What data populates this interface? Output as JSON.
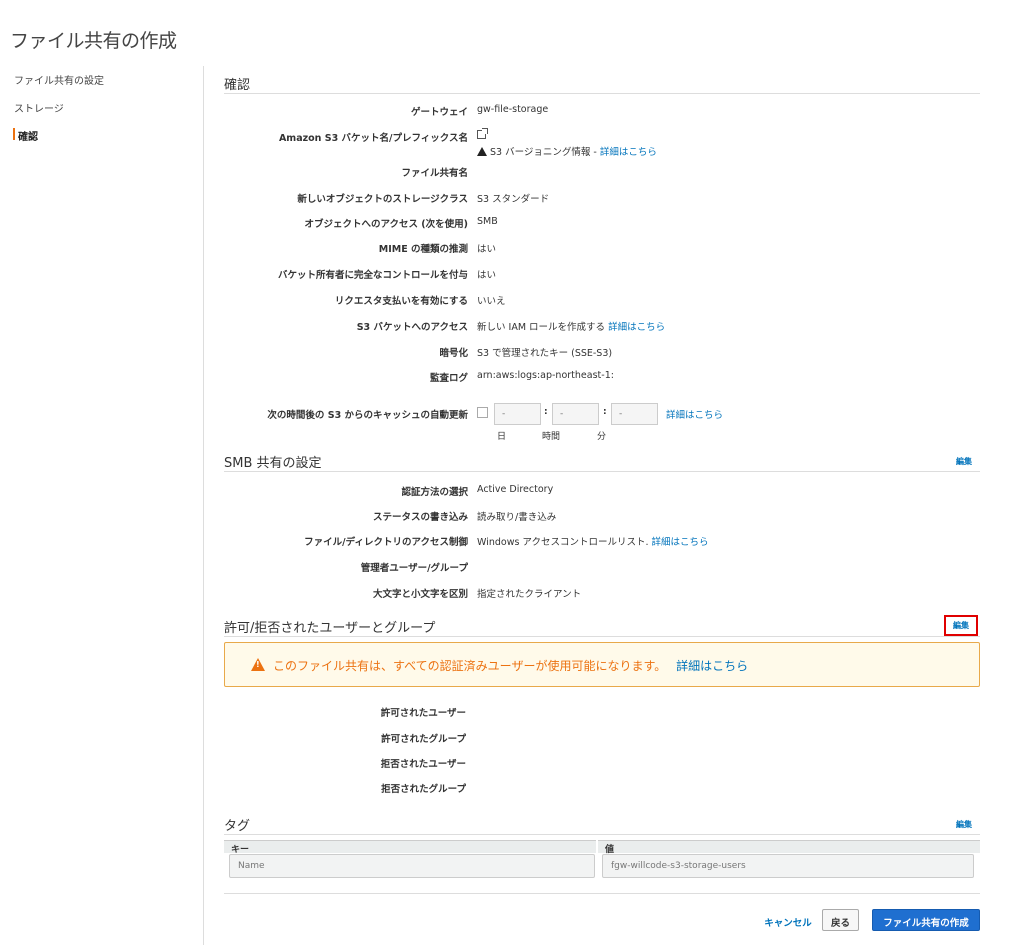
{
  "page_title": "ファイル共有の作成",
  "sidebar": {
    "items": [
      {
        "label": "ファイル共有の設定",
        "active": false
      },
      {
        "label": "ストレージ",
        "active": false
      },
      {
        "label": "確認",
        "active": true
      }
    ]
  },
  "confirm": {
    "title": "確認",
    "rows": {
      "gateway": {
        "label": "ゲートウェイ",
        "value": "gw-file-storage"
      },
      "bucket": {
        "label": "Amazon S3 バケット名/プレフィックス名",
        "warning": "S3 バージョニング情報 -",
        "link": "詳細はこちら"
      },
      "share_name": {
        "label": "ファイル共有名",
        "value": ""
      },
      "storage_class": {
        "label": "新しいオブジェクトのストレージクラス",
        "value": "S3 スタンダード"
      },
      "access": {
        "label": "オブジェクトへのアクセス (次を使用)",
        "value": "SMB"
      },
      "mime": {
        "label": "MIME の種類の推測",
        "value": "はい"
      },
      "owner_control": {
        "label": "バケット所有者に完全なコントロールを付与",
        "value": "はい"
      },
      "requester_pays": {
        "label": "リクエスタ支払いを有効にする",
        "value": "いいえ"
      },
      "s3_access": {
        "label": "S3 バケットへのアクセス",
        "value": "新しい IAM ロールを作成する",
        "link": "詳細はこちら"
      },
      "encryption": {
        "label": "暗号化",
        "value": "S3 で管理されたキー (SSE-S3)"
      },
      "audit_log": {
        "label": "監査ログ",
        "value": "arn:aws:logs:ap-northeast-1:"
      },
      "cache_refresh": {
        "label": "次の時間後の S3 からのキャッシュの自動更新",
        "days_value": "-",
        "hours_value": "-",
        "minutes_value": "-",
        "days_unit": "日",
        "hours_unit": "時間",
        "minutes_unit": "分",
        "link": "詳細はこちら",
        "checked": false
      }
    }
  },
  "smb": {
    "title": "SMB 共有の設定",
    "edit": "編集",
    "rows": {
      "auth": {
        "label": "認証方法の選択",
        "value": "Active Directory"
      },
      "status_write": {
        "label": "ステータスの書き込み",
        "value": "読み取り/書き込み"
      },
      "acl": {
        "label": "ファイル/ディレクトリのアクセス制御",
        "value": "Windows アクセスコントロールリスト.",
        "link": "詳細はこちら"
      },
      "admin": {
        "label": "管理者ユーザー/グループ",
        "value": ""
      },
      "case": {
        "label": "大文字と小文字を区別",
        "value": "指定されたクライアント"
      }
    }
  },
  "allowed": {
    "title": "許可/拒否されたユーザーとグループ",
    "edit": "編集",
    "alert": "このファイル共有は、すべての認証済みユーザーが使用可能になります。",
    "alert_link": "詳細はこちら",
    "rows": {
      "allowed_users": "許可されたユーザー",
      "allowed_groups": "許可されたグループ",
      "denied_users": "拒否されたユーザー",
      "denied_groups": "拒否されたグループ"
    }
  },
  "tags": {
    "title": "タグ",
    "edit": "編集",
    "key_header": "キー",
    "value_header": "値",
    "key": "Name",
    "value": "fgw-willcode-s3-storage-users"
  },
  "footer": {
    "cancel": "キャンセル",
    "back": "戻る",
    "create": "ファイル共有の作成"
  },
  "colors": {
    "accent": "#ec7211",
    "link": "#0073bb",
    "primary_button": "#1f6fd0",
    "highlight_border": "#e00000"
  }
}
